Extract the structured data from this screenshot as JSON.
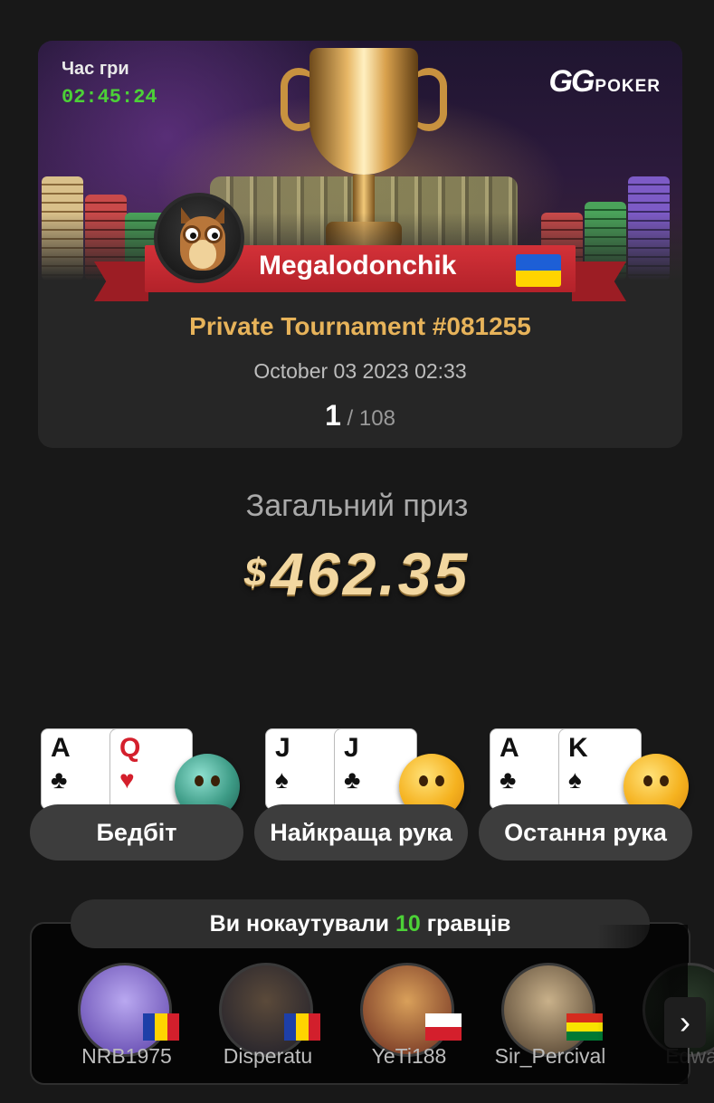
{
  "header": {
    "play_time_label": "Час гри",
    "play_time": "02:45:24",
    "logo_gg": "GG",
    "logo_poker": "POKER"
  },
  "winner": {
    "nickname": "Megalodonchik",
    "flag": "ukraine-flag",
    "avatar": "owl-avatar"
  },
  "tournament": {
    "name": "Private Tournament #081255",
    "date": "October 03 2023 02:33",
    "rank": "1",
    "total": "/ 108"
  },
  "prize": {
    "label": "Загальний приз",
    "currency": "$",
    "amount": "462.35"
  },
  "hands": [
    {
      "label": "Бедбіт",
      "card1": {
        "rank": "A",
        "suit": "♣",
        "red": false
      },
      "card2": {
        "rank": "Q",
        "suit": "♥",
        "red": true
      },
      "emoji": "crying-face-icon"
    },
    {
      "label": "Найкраща рука",
      "card1": {
        "rank": "J",
        "suit": "♠",
        "red": false
      },
      "card2": {
        "rank": "J",
        "suit": "♣",
        "red": false
      },
      "emoji": "thinking-face-icon"
    },
    {
      "label": "Остання рука",
      "card1": {
        "rank": "A",
        "suit": "♣",
        "red": false
      },
      "card2": {
        "rank": "K",
        "suit": "♠",
        "red": false
      },
      "emoji": "facepalm-face-icon"
    }
  ],
  "knockouts": {
    "prefix": "Ви нокаутували ",
    "count": "10",
    "suffix": " гравців",
    "players": [
      {
        "name": "NRB1975",
        "flag": "romania-flag"
      },
      {
        "name": "Disperatu",
        "flag": "romania-flag"
      },
      {
        "name": "YeTi188",
        "flag": "poland-flag"
      },
      {
        "name": "Sir_Percival",
        "flag": "bolivia-flag"
      },
      {
        "name": "Edwa",
        "flag": ""
      }
    ],
    "next_icon": "›"
  },
  "colors": {
    "accent_gold": "#e7b35a",
    "timer_green": "#4cd137",
    "ribbon_red": "#d33138"
  }
}
